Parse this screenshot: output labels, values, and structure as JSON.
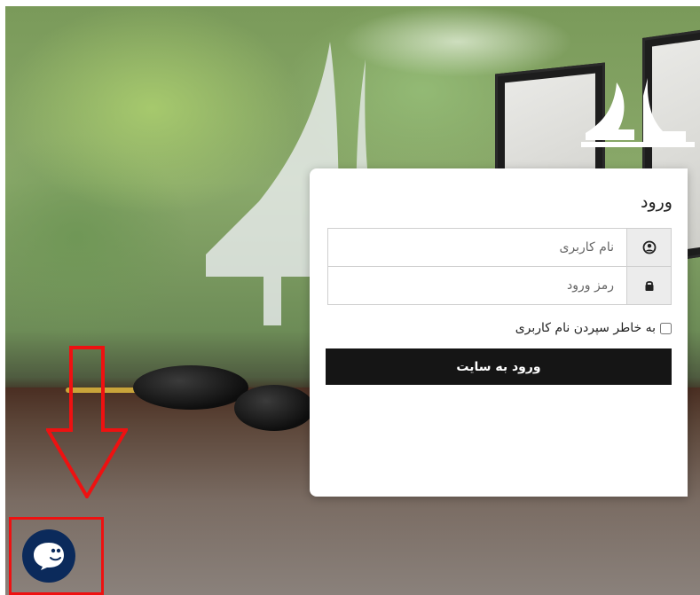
{
  "login": {
    "title": "ورود",
    "username": {
      "placeholder": "نام کاربری",
      "value": "",
      "icon": "user-circle-icon"
    },
    "password": {
      "placeholder": "رمز ورود",
      "value": "",
      "icon": "lock-icon"
    },
    "remember_label": "به خاطر سپردن نام کاربری",
    "remember_checked": false,
    "submit_label": "ورود به سایت"
  },
  "chat_widget": {
    "icon": "chat-bubble-icon",
    "color": "#0b2a5b"
  },
  "annotation": {
    "color": "#e11111",
    "arrow": "down-arrow-icon"
  }
}
